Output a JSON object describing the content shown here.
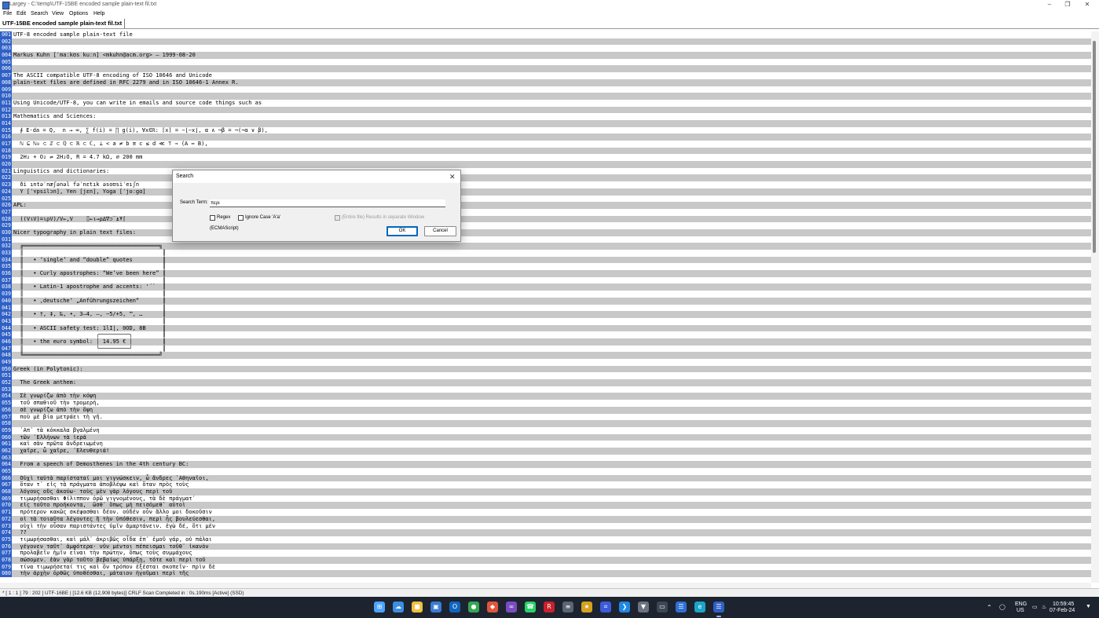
{
  "window": {
    "title": "Largey - C:\\temp\\UTF-15BE encoded sample plain-text fil.txt",
    "minimize": "–",
    "restore": "❐",
    "close": "✕"
  },
  "menu": [
    "File",
    "Edit",
    "Search",
    "View",
    "Options",
    "Help"
  ],
  "tab": {
    "label": "UTF-15BE encoded sample plain-text fil.txt"
  },
  "lines": [
    "UTF-8 encoded sample plain-text file",
    "",
    "",
    "Markus Kuhn [ˈmaːkʊs kuːn] <mkuhn@acm.org> — 1999-08-20",
    "",
    "",
    "The ASCII compatible UTF-8 encoding of ISO 10646 and Unicode",
    "plain-text files are defined in RFC 2279 and in ISO 10646-1 Annex R.",
    "",
    "",
    "Using Unicode/UTF-8, you can write in emails and source code things such as",
    "",
    "Mathematics and Sciences:",
    "",
    "  ∮ E⋅da = Q,  n → ∞, ∑ f(i) = ∏ g(i), ∀x∈ℝ: ⌈x⌉ = −⌊−x⌋, α ∧ ¬β = ¬(¬α ∨ β),",
    "",
    "  ℕ ⊆ ℕ₀ ⊂ ℤ ⊂ ℚ ⊂ ℝ ⊂ ℂ, ⊥ < a ≠ b ≡ c ≤ d ≪ ⊤ ⇒ (A ⇔ B),",
    "",
    "  2H₂ + O₂ ⇌ 2H₂O, R = 4.7 kΩ, ⌀ 200 mm",
    "",
    "Linguistics and dictionaries:",
    "",
    "  ði ıntəˈnæʃənəl fəˈnɛtık əsoʊsiˈeıʃn",
    "  Y [ˈʏpsilɔn], Yen [jɛn], Yoga [ˈjoːgɑ]",
    "",
    "APL:",
    "",
    "  ((V⍳V)=⍳⍴V)/V←,V    ⌷←⍳→⍴∆∇⊃‾⍎⍕⌈",
    "",
    "Nicer typography in plain text files:",
    "",
    "  ╔═════════════════════════════════════════╗",
    "  ║                                          ║",
    "  ║   • ‘single’ and “double” quotes         ║",
    "  ║                                          ║",
    "  ║   • Curly apostrophes: “We’ve been here” ║",
    "  ║                                          ║",
    "  ║   • Latin-1 apostrophe and accents: '´`  ║",
    "  ║                                          ║",
    "  ║   • ‚deutsche‘ „Anführungszeichen“       ║",
    "  ║                                          ║",
    "  ║   • †, ‡, ‰, •, 3–4, —, −5/+5, ™, …      ║",
    "  ║                                          ║",
    "  ║   • ASCII safety test: 1lI|, 0OD, 8B     ║",
    "  ║                      ╭─────────╮         ║",
    "  ║   • the euro symbol: │ 14.95 € │         ║",
    "  ║                      ╰─────────╯         ║",
    "  ╚═════════════════════════════════════════╝",
    "",
    "Greek (in Polytonic):",
    "",
    "  The Greek anthem:",
    "",
    "  Σὲ γνωρίζω ἀπὸ τὴν κόψη",
    "  τοῦ σπαθιοῦ τὴν τρομερή,",
    "  σὲ γνωρίζω ἀπὸ τὴν ὄψη",
    "  ποὺ μὲ βία μετράει τὴ γῆ.",
    "",
    "  ᾿Απ᾿ τὰ κόκκαλα βγαλμένη",
    "  τῶν ᾿Ελλήνων τὰ ἱερά",
    "  καὶ σὰν πρῶτα ἀνδρειωμένη",
    "  χαῖρε, ὦ χαῖρε, ᾿Ελευθεριά!",
    "",
    "  From a speech of Demosthenes in the 4th century BC:",
    "",
    "  Οὐχὶ ταὐτὰ παρίσταταί μοι γιγνώσκειν, ὦ ἄνδρες ᾿Αθηναῖοι,",
    "  ὅταν τ᾿ εἰς τὰ πράγματα ἀποβλέψω καὶ ὅταν πρὸς τοὺς",
    "  λόγους οὓς ἀκούω· τοὺς μὲν γὰρ λόγους περὶ τοῦ",
    "  τιμωρήσασθαι Φίλιππον ὁρῶ γιγνομένους, τὰ δὲ πράγματ᾿",
    "  εἰς τοῦτο προήκοντα,  ὥσθ᾿ ὅπως μὴ πεισόμεθ᾿ αὐτοὶ",
    "  πρότερον κακῶς σκέψασθαι δέον. οὐδέν οὖν ἄλλο μοι δοκοῦσιν",
    "  οἱ τὰ τοιαῦτα λέγοντες ἢ τὴν ὑπόθεσιν, περὶ ἧς βουλεύεσθαι,",
    "  οὐχὶ τὴν οὖσαν παριστάντες ὑμῖν ἁμαρτάνειν. ἐγὼ δέ, ὅτι μέν",
    "  ??",
    "  τιμωρήσασθαι, καὶ μάλ᾿ ἀκριβῶς οἶδα ἐπ᾿ ἐμοῦ γάρ, οὐ πάλαι",
    "  γέγονεν ταῦτ᾿ ἀμφότερα· νῦν μέντοι πέπεισμαι τοῦθ᾿ ἱκανὸν",
    "  προλαβεῖν ἡμῖν εἶναι τὴν πρώτην, ὅπως τοὺς συμμάχους",
    "  σώσομεν. ἐὰν γὰρ τοῦτο βεβαίως ὑπάρξῃ, τότε καὶ περὶ τοῦ",
    "  τίνα τιμωρήσεταί τις καὶ ὃν τρόπον ἐξέσται σκοπεῖν· πρὶν δὲ",
    "  τὴν ἀρχὴν ὀρθῶς ὑποθέσθαι, μάταιον ἡγοῦμαι περὶ τῆς"
  ],
  "dialog": {
    "title": "Search",
    "close": "✕",
    "search_term_label": "Search Term:",
    "search_term_value": "περι",
    "regex_label": "Regex",
    "ignore_case_label": "Ignore Case 'A'a'",
    "entire_file_label": "(Entire file) Results in separate Window",
    "ecma_label": "(ECMAScript)",
    "ok_label": "OK",
    "cancel_label": "Cancel"
  },
  "status": {
    "text": "* [ 1 : 1 ] 79 : 202 ] UTF-16BE | [12.6 KB (12,908 bytes)] CRLF Scan Completed in : 0s.190ms [Active] (SSD)"
  },
  "taskbar": {
    "icons": [
      {
        "name": "windows-start-icon",
        "glyph": "⊞",
        "color": "#4aa3ff"
      },
      {
        "name": "widgets-icon",
        "glyph": "☁",
        "color": "#3b8fe0"
      },
      {
        "name": "file-explorer-icon",
        "glyph": "■",
        "color": "#f2c03a"
      },
      {
        "name": "store-icon",
        "glyph": "▣",
        "color": "#3a7bd5"
      },
      {
        "name": "outlook-icon",
        "glyph": "O",
        "color": "#1165c0"
      },
      {
        "name": "chrome-icon",
        "glyph": "●",
        "color": "#34a853"
      },
      {
        "name": "paint-icon",
        "glyph": "◆",
        "color": "#e0563b"
      },
      {
        "name": "visual-studio-icon",
        "glyph": "∞",
        "color": "#7a4cc2"
      },
      {
        "name": "whatsapp-icon",
        "glyph": "☎",
        "color": "#25d366"
      },
      {
        "name": "red-app-icon",
        "glyph": "R",
        "color": "#c8202c"
      },
      {
        "name": "calculator-icon",
        "glyph": "≡",
        "color": "#5b6473"
      },
      {
        "name": "yellow-app-icon",
        "glyph": "★",
        "color": "#d6a21c"
      },
      {
        "name": "grid-app-icon",
        "glyph": "⌗",
        "color": "#3b5bdb"
      },
      {
        "name": "vscode-icon",
        "glyph": "❯",
        "color": "#1e88e5"
      },
      {
        "name": "shield-app-icon",
        "glyph": "▼",
        "color": "#6b7280"
      },
      {
        "name": "terminal-icon",
        "glyph": "▭",
        "color": "#3d4654"
      },
      {
        "name": "notepad-icon",
        "glyph": "☰",
        "color": "#2f6fd6"
      },
      {
        "name": "edge-icon",
        "glyph": "e",
        "color": "#1aa5c9"
      },
      {
        "name": "largey-icon",
        "glyph": "☰",
        "color": "#2f60c6"
      }
    ],
    "lang": "ENG",
    "region": "US",
    "time": "10:59:45",
    "date": "07-Feb-24"
  }
}
